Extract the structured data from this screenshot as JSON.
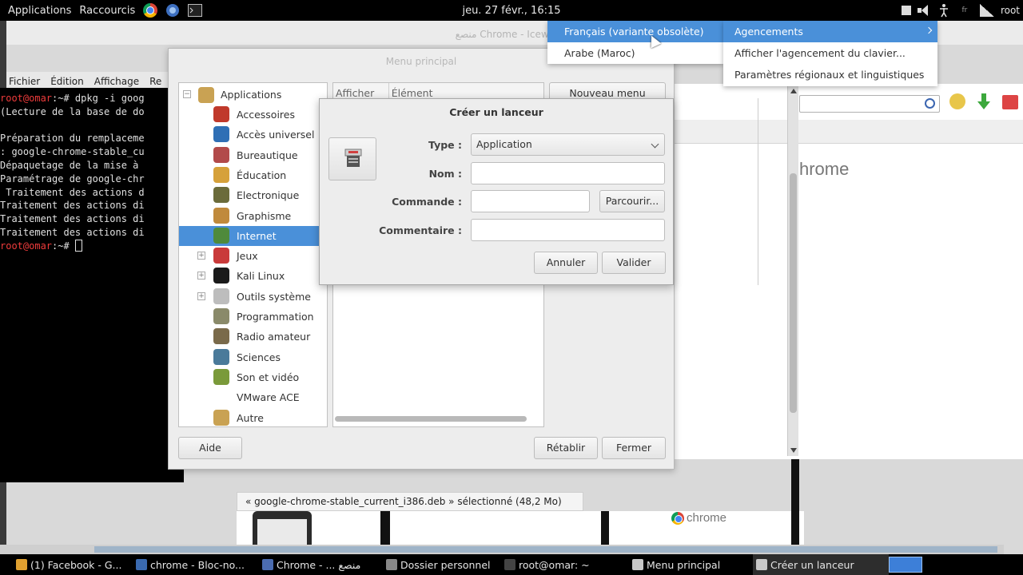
{
  "top_panel": {
    "applications": "Applications",
    "shortcuts": "Raccourcis",
    "clock": "jeu. 27 févr., 16:15",
    "user": "root",
    "kb_indicator": "fr"
  },
  "bg_window": {
    "title": "منصع Chrome - Iceweasel",
    "menubar": [
      "Fichier",
      "Édition",
      "Affichage",
      "Re"
    ]
  },
  "terminal": {
    "lines": [
      {
        "prompt": "root@omar",
        "text": ":~# dpkg -i goog"
      },
      {
        "text": "(Lecture de la base de do"
      },
      {
        "text": ""
      },
      {
        "text": "Préparation du remplaceme"
      },
      {
        "text": ": google-chrome-stable_cu"
      },
      {
        "text": "Dépaquetage de la mise à"
      },
      {
        "text": "Paramétrage de google-chr"
      },
      {
        "text": " Traitement des actions d"
      },
      {
        "text": "Traitement des actions di"
      },
      {
        "text": "Traitement des actions di"
      },
      {
        "text": "Traitement des actions di"
      },
      {
        "prompt": "root@omar",
        "text": ":~# "
      }
    ]
  },
  "browser": {
    "chrome_text": "hrome",
    "status_bar": "« google-chrome-stable_current_i386.deb » sélectionné (48,2 Mo)",
    "logo_text": "chrome"
  },
  "menu_window": {
    "title": "Menu principal",
    "root": "Applications",
    "categories": [
      {
        "label": "Accessoires",
        "color": "#c0392b",
        "expandable": false
      },
      {
        "label": "Accès universel",
        "color": "#2f6fb5",
        "expandable": false
      },
      {
        "label": "Bureautique",
        "color": "#b24a4a",
        "expandable": false
      },
      {
        "label": "Éducation",
        "color": "#d6a13a",
        "expandable": false
      },
      {
        "label": "Electronique",
        "color": "#6b6b3a",
        "expandable": false
      },
      {
        "label": "Graphisme",
        "color": "#c08a3c",
        "expandable": false
      },
      {
        "label": "Internet",
        "color": "#4f8a3b",
        "expandable": false,
        "selected": true
      },
      {
        "label": "Jeux",
        "color": "#c93a3a",
        "expandable": true
      },
      {
        "label": "Kali Linux",
        "color": "#1a1a1a",
        "expandable": true
      },
      {
        "label": "Outils système",
        "color": "#bdbdbd",
        "expandable": true
      },
      {
        "label": "Programmation",
        "color": "#8a8a6a",
        "expandable": false
      },
      {
        "label": "Radio amateur",
        "color": "#7a6a4a",
        "expandable": false
      },
      {
        "label": "Sciences",
        "color": "#4a7a9a",
        "expandable": false
      },
      {
        "label": "Son et vidéo",
        "color": "#7a9a3a",
        "expandable": false
      },
      {
        "label": "VMware ACE",
        "color": "",
        "expandable": false
      },
      {
        "label": "Autre",
        "color": "#c9a253",
        "expandable": false
      }
    ],
    "col_show": "Afficher",
    "col_item": "Élément",
    "new_menu": "Nouveau menu",
    "help": "Aide",
    "revert": "Rétablir",
    "close": "Fermer"
  },
  "launcher": {
    "title": "Créer un lanceur",
    "type_label": "Type :",
    "type_value": "Application",
    "name_label": "Nom :",
    "name_value": "",
    "command_label": "Commande :",
    "command_value": "",
    "browse": "Parcourir...",
    "comment_label": "Commentaire :",
    "comment_value": "",
    "cancel": "Annuler",
    "ok": "Valider"
  },
  "layout_menu": {
    "items": [
      "Français (variante obsolète)",
      "Arabe (Maroc)"
    ]
  },
  "input_menu": {
    "items": [
      "Agencements",
      "Afficher l'agencement du clavier...",
      "Paramètres régionaux et linguistiques"
    ]
  },
  "taskbar": {
    "tasks": [
      {
        "label": "(1) Facebook - G...",
        "color": "#e0a030"
      },
      {
        "label": "chrome - Bloc-no...",
        "color": "#3a6ab0"
      },
      {
        "label": "Chrome - ... منصع",
        "color": "#4b6cb0"
      },
      {
        "label": "Dossier personnel",
        "color": "#888888"
      },
      {
        "label": "root@omar: ~",
        "color": "#444444"
      },
      {
        "label": "Menu principal",
        "color": "#c8c8c8"
      },
      {
        "label": "Créer un lanceur",
        "color": "#c8c8c8",
        "active": true
      }
    ]
  }
}
